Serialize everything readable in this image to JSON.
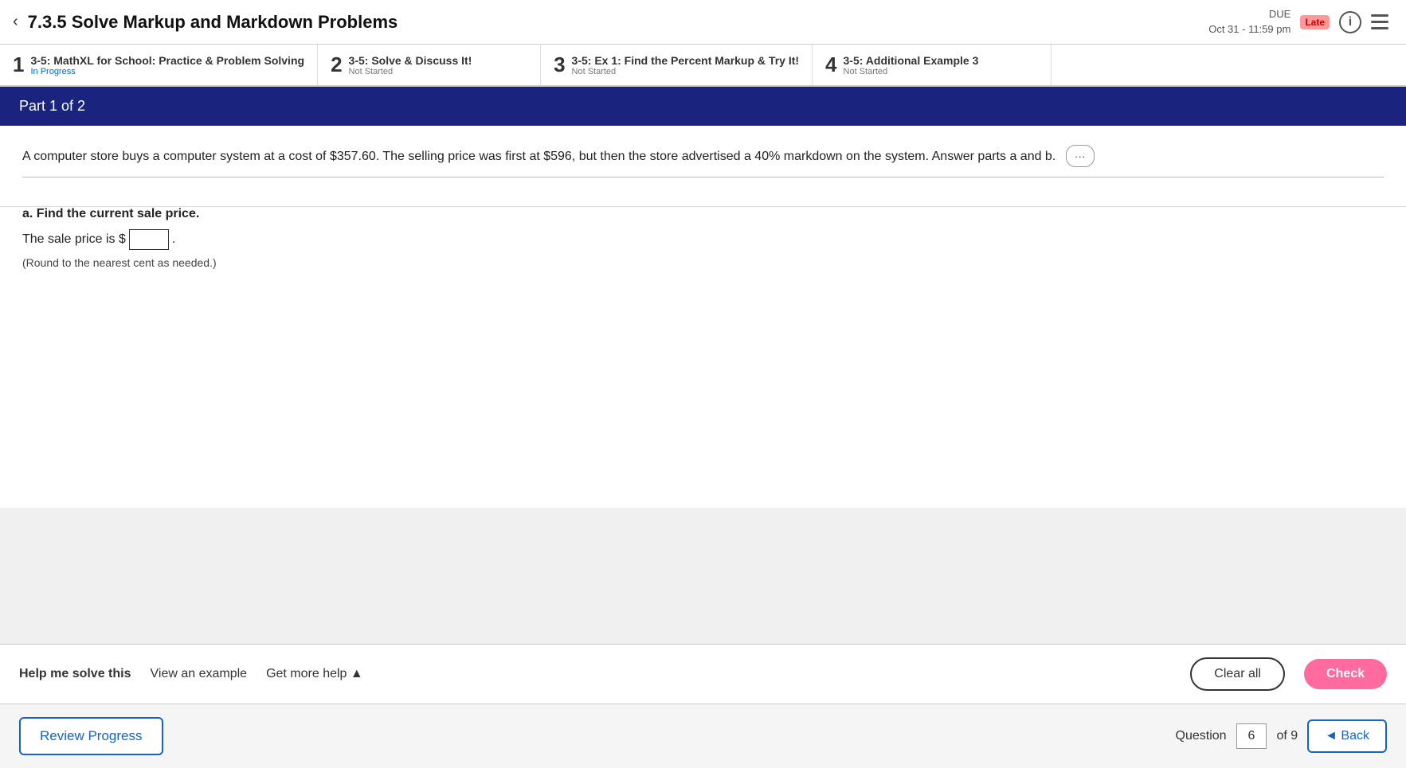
{
  "header": {
    "back_arrow": "‹",
    "lesson_title": "7.3.5 Solve Markup and Markdown Problems",
    "due_label": "DUE",
    "due_date": "Oct 31 - 11:59 pm",
    "late_badge": "Late",
    "info_icon": "i"
  },
  "steps": [
    {
      "number": "1",
      "name": "3-5: MathXL for School: Practice & Problem Solving",
      "status": "In Progress",
      "status_class": "in-progress"
    },
    {
      "number": "2",
      "name": "3-5: Solve & Discuss It!",
      "status": "Not Started",
      "status_class": ""
    },
    {
      "number": "3",
      "name": "3-5: Ex 1: Find the Percent Markup & Try It!",
      "status": "Not Started",
      "status_class": ""
    },
    {
      "number": "4",
      "name": "3-5: Additional Example 3",
      "status": "Not Started",
      "status_class": ""
    }
  ],
  "part_header": "Part 1 of 2",
  "question": {
    "text": "A computer store buys a computer system at a cost of $357.60. The selling price was first at $596, but then the store advertised a 40% markdown on the system. Answer parts a and b.",
    "expand_dots": "···"
  },
  "part_a": {
    "label": "a. Find the current sale price.",
    "answer_prefix": "The sale price is $",
    "answer_note": "(Round to the nearest cent as needed.)"
  },
  "toolbar": {
    "help_me_solve": "Help me solve this",
    "view_example": "View an example",
    "get_more_help": "Get more help ▲",
    "clear_all": "Clear all",
    "check": "Check"
  },
  "footer": {
    "review_progress": "Review Progress",
    "question_label": "Question",
    "question_number": "6",
    "of_total": "of 9",
    "back_btn": "◄ Back"
  }
}
